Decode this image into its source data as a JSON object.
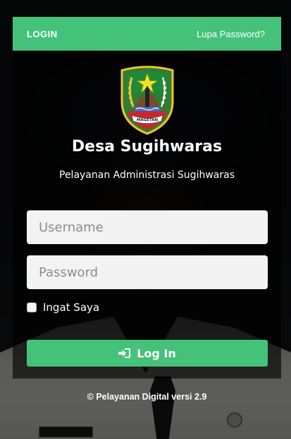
{
  "header": {
    "title": "LOGIN",
    "forgot_password_link": "Lupa Password?"
  },
  "branding": {
    "logo_icon": "magetan-regency-emblem-icon",
    "logo_text": "MAGETAN",
    "site_title": "Desa Sugihwaras",
    "site_subtitle": "Pelayanan Administrasi Sugihwaras"
  },
  "form": {
    "username_placeholder": "Username",
    "username_value": "",
    "password_placeholder": "Password",
    "password_value": "",
    "remember_label": "Ingat Saya",
    "remember_checked": false,
    "login_icon": "sign-in-icon",
    "login_label": "Log In"
  },
  "footer": {
    "text": "© Pelayanan Digital versi 2.9"
  },
  "colors": {
    "accent": "#45c27a",
    "panel_overlay": "rgba(0,0,0,0.62)",
    "input_bg": "#f3f3f3",
    "text_light": "#ffffff"
  }
}
